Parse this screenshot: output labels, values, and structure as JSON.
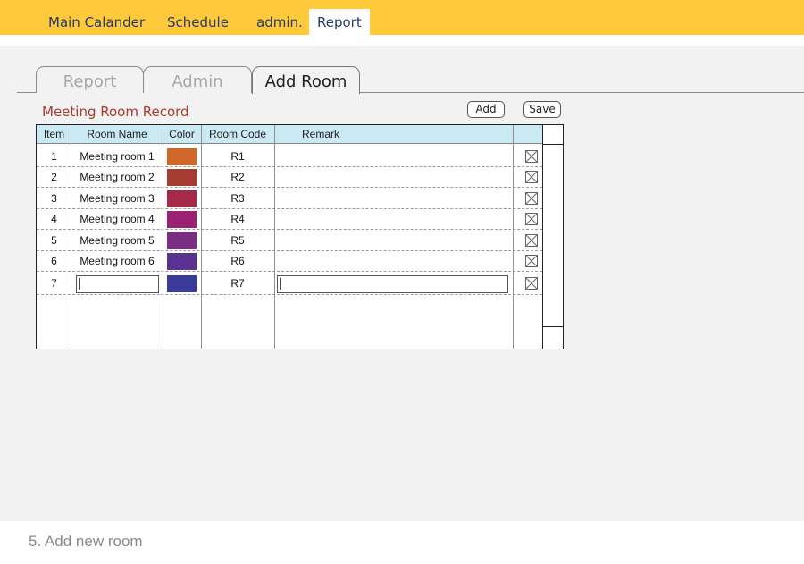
{
  "nav": {
    "items": [
      {
        "label": "Main Calander"
      },
      {
        "label": "Schedule"
      },
      {
        "label": "admin."
      },
      {
        "label": "Report",
        "active": true
      }
    ]
  },
  "subtabs": [
    {
      "label": "Report"
    },
    {
      "label": "Admin"
    },
    {
      "label": "Add Room",
      "active": true
    }
  ],
  "section": {
    "title": "Meeting Room Record",
    "add_label": "Add",
    "save_label": "Save"
  },
  "table": {
    "headers": {
      "item": "Item",
      "room_name": "Room Name",
      "color": "Color",
      "room_code": "Room Code",
      "remark": "Remark"
    },
    "rows": [
      {
        "item": "1",
        "name": "Meeting room 1",
        "color": "#d2672a",
        "code": "R1",
        "remark": ""
      },
      {
        "item": "2",
        "name": "Meeting room 2",
        "color": "#a53c33",
        "code": "R2",
        "remark": ""
      },
      {
        "item": "3",
        "name": "Meeting room 3",
        "color": "#a52a4a",
        "code": "R3",
        "remark": ""
      },
      {
        "item": "4",
        "name": "Meeting room 4",
        "color": "#9b2272",
        "code": "R4",
        "remark": ""
      },
      {
        "item": "5",
        "name": "Meeting room 5",
        "color": "#7a2e82",
        "code": "R5",
        "remark": ""
      },
      {
        "item": "6",
        "name": "Meeting room 6",
        "color": "#5a3292",
        "code": "R6",
        "remark": ""
      }
    ],
    "new_row": {
      "item": "7",
      "name": "",
      "color": "#3a3a98",
      "code": "R7",
      "remark": ""
    }
  },
  "caption": "5. Add new room",
  "icons": {
    "delete": "delete-box-icon"
  }
}
